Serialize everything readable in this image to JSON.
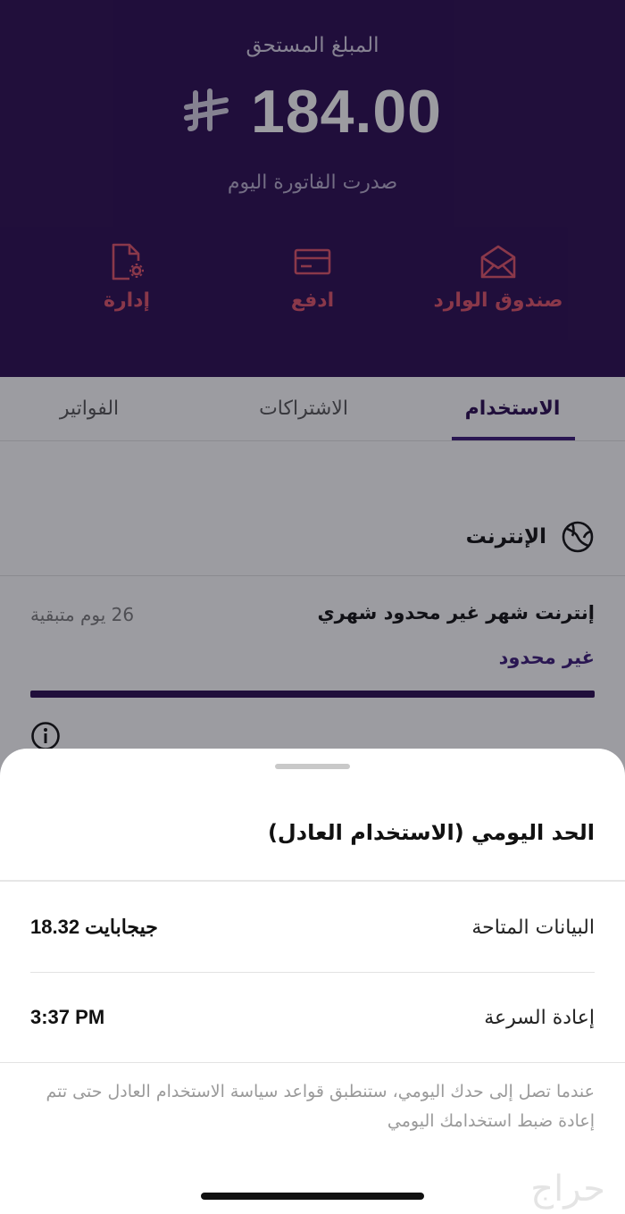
{
  "header": {
    "amount_label": "المبلغ المستحق",
    "amount_value": "184.00",
    "currency_icon": "saudi-riyal-icon",
    "invoice_date": "صدرت الفاتورة اليوم",
    "background_color": "#2a0c50",
    "actions": [
      {
        "label": "صندوق الوارد",
        "icon": "envelope-icon"
      },
      {
        "label": "ادفع",
        "icon": "card-icon"
      },
      {
        "label": "إدارة",
        "icon": "document-gear-icon"
      }
    ],
    "action_color": "#e0546a"
  },
  "tabs": [
    {
      "label": "الاستخدام",
      "active": true
    },
    {
      "label": "الاشتراكات",
      "active": false
    },
    {
      "label": "الفواتير",
      "active": false
    }
  ],
  "internet": {
    "section_title": "الإنترنت",
    "section_icon": "globe-icon",
    "plan_name": "إنترنت شهر غير محدود شهري",
    "remaining": "26 يوم متبقية",
    "limit": "غير محدود",
    "usage_fraction": 1.0,
    "info_icon": "info-icon"
  },
  "sheet": {
    "title": "الحد اليومي (الاستخدام العادل)",
    "rows": [
      {
        "label": "البيانات المتاحة",
        "value": "18.32 جيجابايت"
      },
      {
        "label": "إعادة السرعة",
        "value": "3:37 PM"
      }
    ],
    "note": "عندما تصل إلى حدك اليومي، ستنطبق قواعد سياسة الاستخدام العادل حتى تتم إعادة ضبط استخدامك اليومي"
  },
  "watermark": "حراج"
}
